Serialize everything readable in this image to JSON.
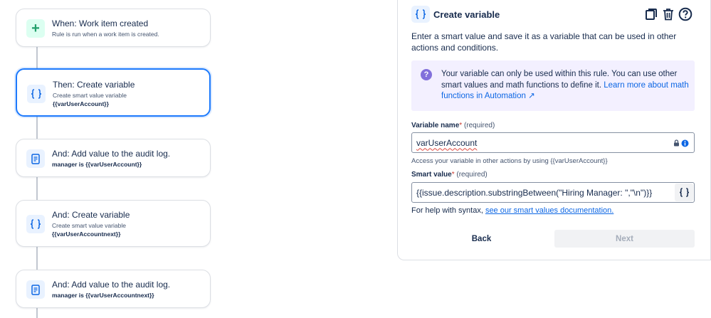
{
  "flow": {
    "cards": [
      {
        "icon": "plus-icon",
        "title": "When: Work item created",
        "sub": "Rule is run when a work item is created.",
        "sub2": ""
      },
      {
        "icon": "braces-icon",
        "title": "Then: Create variable",
        "sub": "Create smart value variable",
        "sub2": "{{varUserAccount}}"
      },
      {
        "icon": "document-icon",
        "title": "And: Add value to the audit log.",
        "sub": "manager is {{varUserAccount}}",
        "sub2": ""
      },
      {
        "icon": "braces-icon",
        "title": "And: Create variable",
        "sub": "Create smart value variable",
        "sub2": "{{varUserAccountnext}}"
      },
      {
        "icon": "document-icon",
        "title": "And: Add value to the audit log.",
        "sub": "manager is {{varUserAccountnext}}",
        "sub2": ""
      }
    ]
  },
  "panel": {
    "title": "Create variable",
    "description": "Enter a smart value and save it as a variable that can be used in other actions and conditions.",
    "info": {
      "text": "Your variable can only be used within this rule. You can use other smart values and math functions to define it.",
      "link": "Learn more about math functions in Automation ↗"
    },
    "variable_name": {
      "label": "Variable name",
      "required_star": "*",
      "required_text": "(required)",
      "value": "varUserAccount",
      "help": "Access your variable in other actions by using {{varUserAccount}}"
    },
    "smart_value": {
      "label": "Smart value",
      "required_star": "*",
      "required_text": "(required)",
      "value": "{{issue.description.substringBetween(\"Hiring Manager: \",\"\\n\")}}"
    },
    "syntax_help": {
      "prefix": "For help with syntax,",
      "link": "see our smart values documentation."
    },
    "buttons": {
      "back": "Back",
      "next": "Next"
    }
  },
  "colors": {
    "accent": "#0c66e4",
    "selected_border": "#1d7afc",
    "trigger_icon": "#22a06b",
    "info_bg": "#f3f0ff",
    "info_icon": "#8270db"
  }
}
